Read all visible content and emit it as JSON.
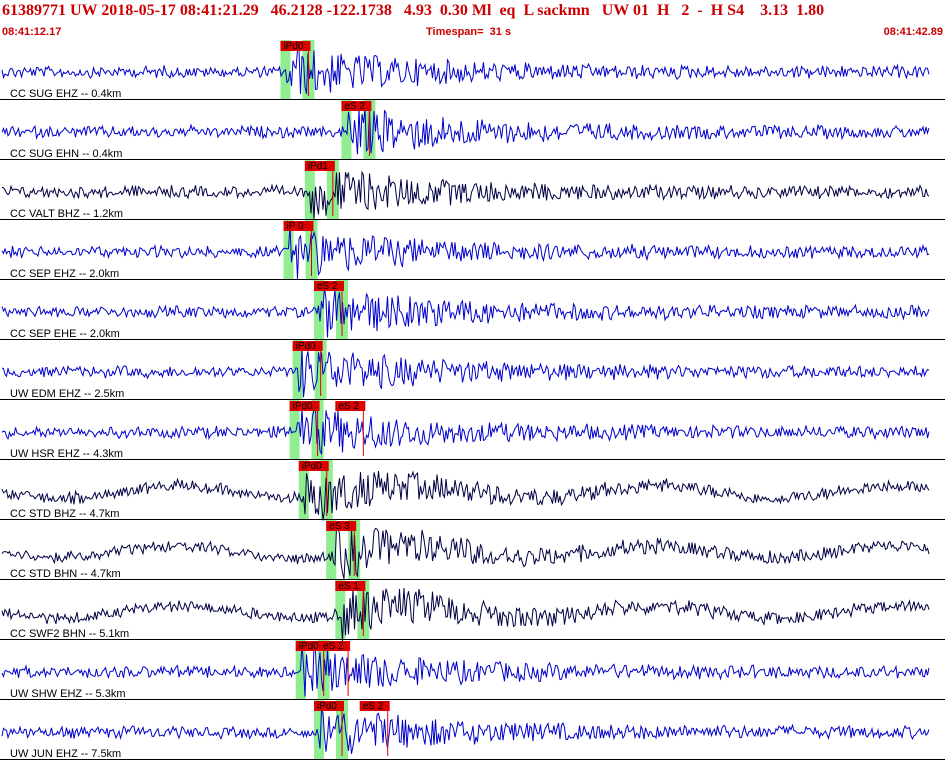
{
  "header": {
    "title": "61389771 UW 2018-05-17 08:41:21.29   46.2128 -122.1738   4.93  0.30 Ml  eq  L sackmn   UW 01  H   2  -  H S4    3.13  1.80",
    "start_time": "08:41:12.17",
    "timespan": "Timespan=  31 s",
    "end_time": "08:41:42.89"
  },
  "colors": {
    "header_text": "#cc0000",
    "trace_primary": "#0000cc",
    "trace_secondary": "#000044",
    "pick_box": "#dd0000",
    "pick_window": "#90ee90",
    "separator": "#000000"
  },
  "traces": [
    {
      "label": "CC SUG EHZ -- 0.4km",
      "color": "#0000cc",
      "picks": [
        {
          "text": "iPd0",
          "time": 9.2
        }
      ]
    },
    {
      "label": "CC SUG EHN -- 0.4km",
      "color": "#0000cc",
      "picks": [
        {
          "text": "eS 2",
          "time": 11.2
        }
      ]
    },
    {
      "label": "CC VALT BHZ -- 1.2km",
      "color": "#000044",
      "picks": [
        {
          "text": "iPd1",
          "time": 10.0
        }
      ]
    },
    {
      "label": "CC SEP EHZ -- 2.0km",
      "color": "#0000cc",
      "picks": [
        {
          "text": "iP 0",
          "time": 9.3
        }
      ]
    },
    {
      "label": "CC SEP EHE -- 2.0km",
      "color": "#0000cc",
      "picks": [
        {
          "text": "eS 2",
          "time": 10.3
        }
      ]
    },
    {
      "label": "UW EDM EHZ -- 2.5km",
      "color": "#0000cc",
      "picks": [
        {
          "text": "iPd0",
          "time": 9.6
        }
      ]
    },
    {
      "label": "UW HSR EHZ -- 4.3km",
      "color": "#0000cc",
      "picks": [
        {
          "text": "iPd0",
          "time": 9.5
        },
        {
          "text": "eS 2",
          "time": 11.0
        }
      ]
    },
    {
      "label": "CC STD BHZ -- 4.7km",
      "color": "#000044",
      "picks": [
        {
          "text": "iPd0",
          "time": 9.8
        }
      ]
    },
    {
      "label": "CC STD BHN -- 4.7km",
      "color": "#000044",
      "picks": [
        {
          "text": "eS 3",
          "time": 10.7
        }
      ]
    },
    {
      "label": "CC SWF2 BHN -- 5.1km",
      "color": "#000044",
      "picks": [
        {
          "text": "eS 1",
          "time": 11.0
        }
      ]
    },
    {
      "label": "UW SHW EHZ -- 5.3km",
      "color": "#0000cc",
      "picks": [
        {
          "text": "iPd0",
          "time": 9.7
        },
        {
          "text": "eS 2",
          "time": 10.5
        }
      ]
    },
    {
      "label": "UW JUN EHZ -- 7.5km",
      "color": "#0000cc",
      "picks": [
        {
          "text": "iPd0",
          "time": 10.3
        },
        {
          "text": "eS 2",
          "time": 11.8
        }
      ]
    }
  ]
}
